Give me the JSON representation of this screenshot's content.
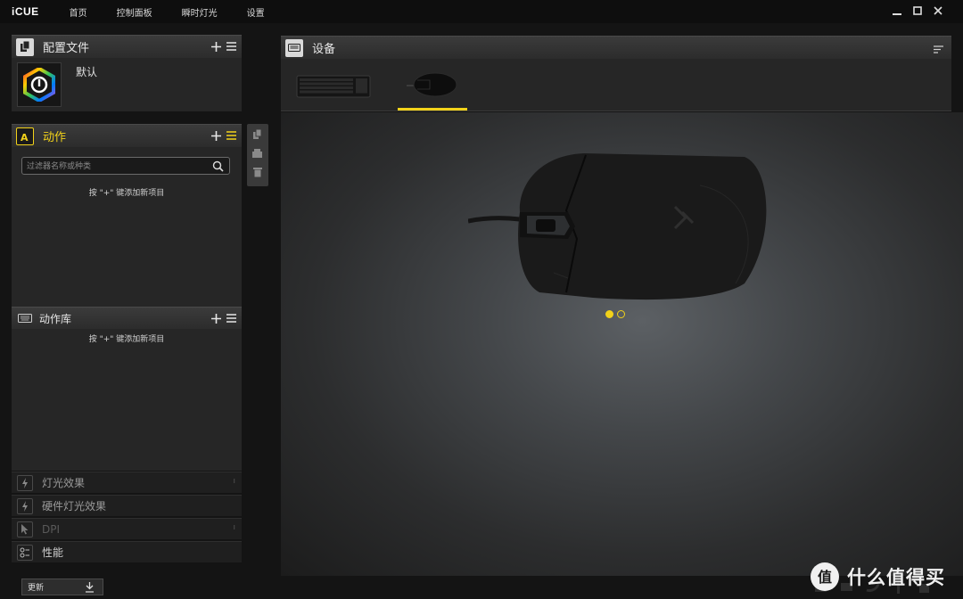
{
  "app": {
    "title": "iCUE"
  },
  "nav": {
    "items": [
      "首页",
      "控制面板",
      "瞬时灯光",
      "设置"
    ]
  },
  "profiles": {
    "title": "配置文件",
    "items": [
      {
        "name": "默认"
      }
    ]
  },
  "actions": {
    "title": "动作",
    "search_placeholder": "过滤器名称或种类",
    "empty_hint": "按 \"+\" 键添加新项目"
  },
  "action_library": {
    "title": "动作库",
    "empty_hint": "按 \"+\" 键添加新项目"
  },
  "sections": [
    {
      "label": "灯光效果",
      "icon": "lightning-icon"
    },
    {
      "label": "硬件灯光效果",
      "icon": "lightning-icon"
    },
    {
      "label": "DPI",
      "icon": "cursor-icon"
    },
    {
      "label": "性能",
      "icon": "performance-icon"
    }
  ],
  "devices": {
    "title": "设备",
    "tabs": [
      {
        "name": "keyboard"
      },
      {
        "name": "mouse"
      }
    ],
    "selected_tab": 1,
    "page_count": 2,
    "current_page": 1
  },
  "footer": {
    "update_label": "更新"
  },
  "watermark": {
    "text": "什么值得买",
    "logo_char": "值"
  },
  "colors": {
    "accent": "#f2d21a",
    "panel": "#262626",
    "header": "#333333"
  }
}
